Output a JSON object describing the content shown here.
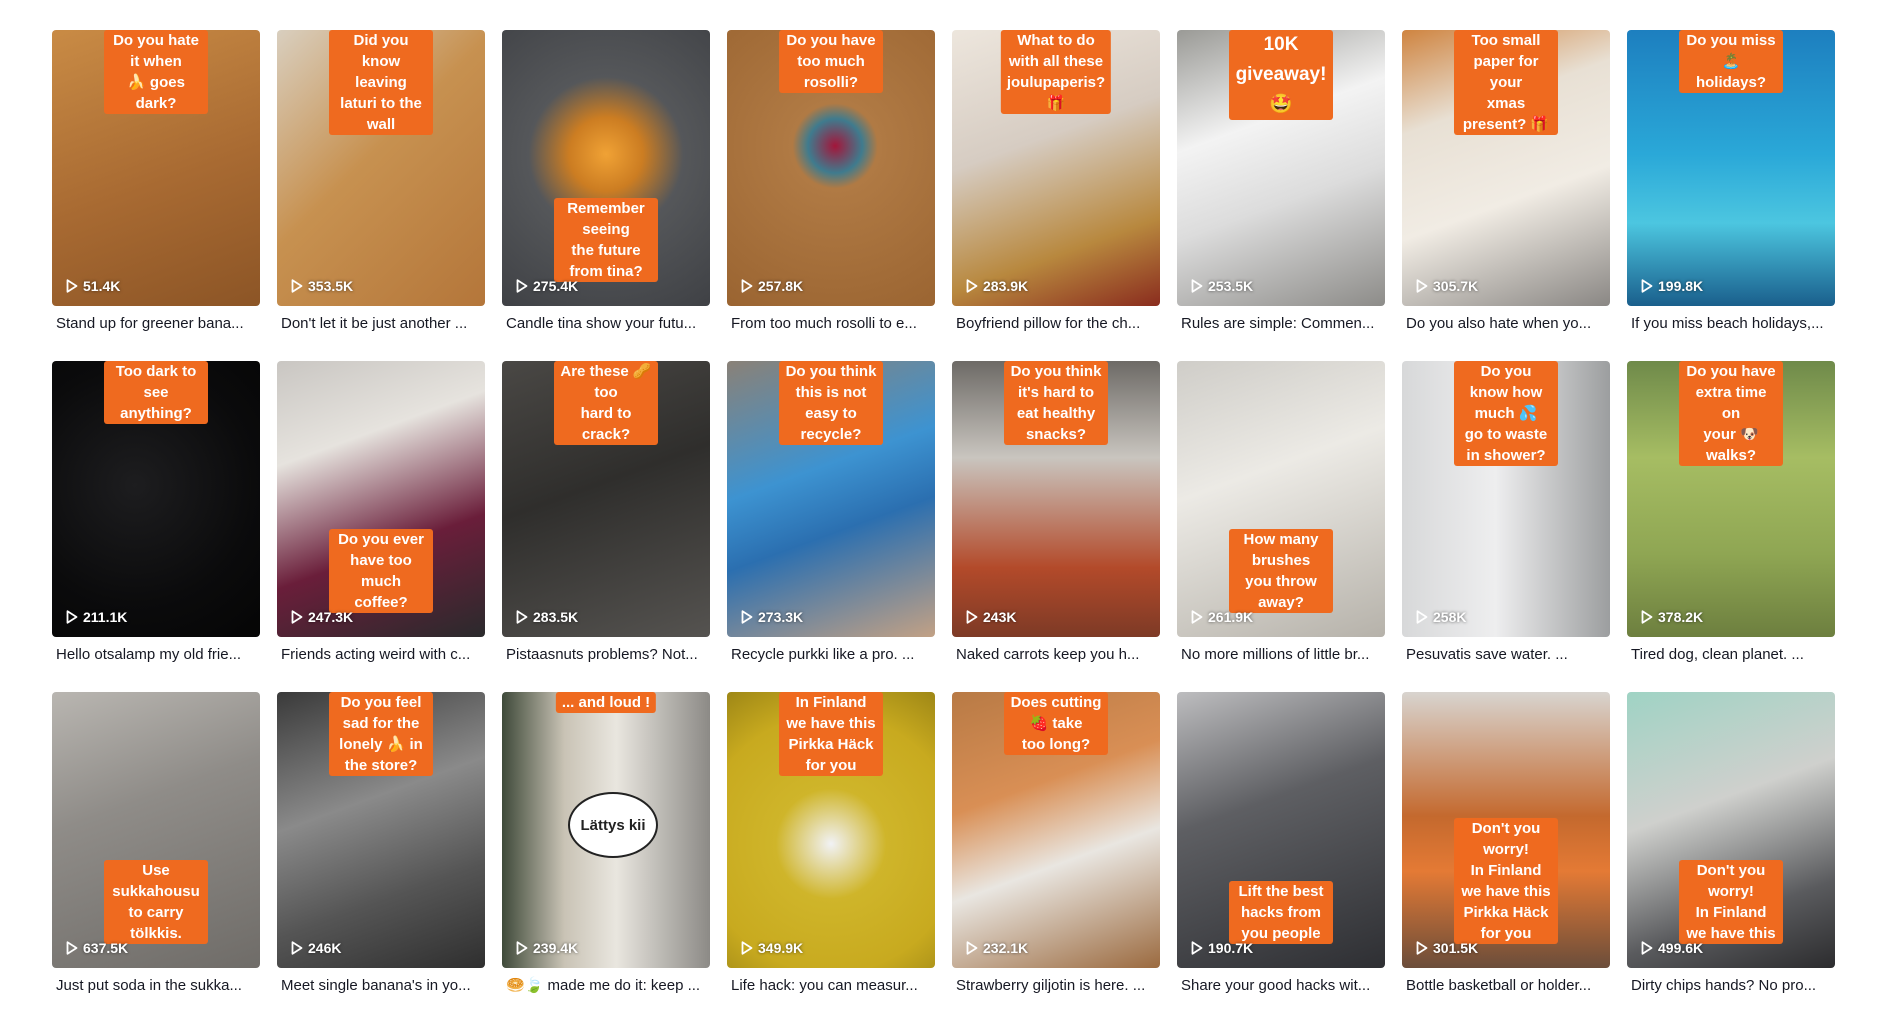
{
  "videos": [
    {
      "caption": "Do you hate it when\n🍌 goes dark?",
      "caption_pos": "top",
      "views": "51.4K",
      "desc": "Stand up for greener bana...",
      "bg": "linear-gradient(160deg,#c98b45 0%,#a86a32 55%,#8c5526 100%)"
    },
    {
      "caption": "Did you know leaving\nlaturi to the wall",
      "caption_pos": "top",
      "views": "353.5K",
      "desc": "Don't let it be just another ...",
      "bg": "linear-gradient(135deg,#d9cfbf 0%,#c79150 45%,#b4763a 100%)"
    },
    {
      "caption": "Remember seeing\nthe future from tina?",
      "caption_pos": "bottom",
      "views": "275.4K",
      "desc": "Candle tina show your futu...",
      "bg": "radial-gradient(circle at 50% 45%,#f0a235 0%,#cc7d22 20%,#55575a 42%,#3f4145 100%)"
    },
    {
      "caption": "Do you have\ntoo much rosolli?",
      "caption_pos": "top",
      "views": "257.8K",
      "desc": "From too much rosolli to e...",
      "bg": "radial-gradient(circle at 52% 42%,#a3163a 0%,#3f7b8e 14%,#b07a44 22%,#9a6431 100%)"
    },
    {
      "caption": "What to do with all these\njoulupaperis? 🎁",
      "caption_pos": "top",
      "views": "283.9K",
      "desc": "Boyfriend pillow for the ch...",
      "bg": "linear-gradient(160deg,#ede6dd 0%,#d6ccc2 40%,#b8883e 75%,#8a2c1e 100%)"
    },
    {
      "caption": "10K giveaway! 🤩",
      "caption_pos": "top",
      "wide": true,
      "views": "253.5K",
      "desc": "Rules are simple: Commen...",
      "bg": "linear-gradient(160deg,#9a9a96 0%,#f3f3f3 35%,#dcdcdc 60%,#8d8c89 100%)"
    },
    {
      "caption": "Too small paper for your\nxmas present? 🎁",
      "caption_pos": "top",
      "views": "305.7K",
      "desc": "Do you also hate when yo...",
      "bg": "linear-gradient(160deg,#cf8440 0%,#e8e0d4 30%,#f1ece4 60%,#8a8784 100%)"
    },
    {
      "caption": "Do you miss 🏝️ holidays?",
      "caption_pos": "top",
      "views": "199.8K",
      "desc": "If you miss beach holidays,...",
      "bg": "linear-gradient(180deg,#1d7fbf 0%,#2aa8d8 45%,#4cc6e0 70%,#1a5f8c 100%)"
    },
    {
      "caption": "Too dark to see anything?",
      "caption_pos": "top",
      "views": "211.1K",
      "desc": "Hello otsalamp my old frie...",
      "bg": "radial-gradient(circle at 40% 45%,#1d1d1f 0%,#0b0b0c 60%,#050505 100%)"
    },
    {
      "caption": "Do you ever have too\nmuch coffee?",
      "caption_pos": "bottom",
      "views": "247.3K",
      "desc": "Friends acting weird with c...",
      "bg": "linear-gradient(160deg,#c9c6c2 0%,#e6e3de 30%,#6a1e3a 65%,#2a2a2c 100%)"
    },
    {
      "caption": "Are these 🥜 too\nhard to crack?",
      "caption_pos": "top",
      "views": "283.5K",
      "desc": "Pistaasnuts problems? Not...",
      "bg": "linear-gradient(160deg,#4a4845 0%,#2f2e2c 45%,#555350 100%)"
    },
    {
      "caption": "Do you think this is not\neasy to recycle?",
      "caption_pos": "top",
      "views": "273.3K",
      "desc": "Recycle purkki like a pro. ...",
      "bg": "linear-gradient(160deg,#8a8177 0%,#3d93d1 40%,#2b6fb0 60%,#c2a185 100%)"
    },
    {
      "caption": "Do you think it's hard to\neat healthy snacks?",
      "caption_pos": "top",
      "views": "243K",
      "desc": "Naked carrots keep you h...",
      "bg": "linear-gradient(180deg,#6d6a66 0%,#c9c5bf 35%,#b34a2a 75%,#7d3a26 100%)"
    },
    {
      "caption": "How many brushes\nyou throw away?",
      "caption_pos": "bottom",
      "views": "261.9K",
      "desc": "No more millions of little br...",
      "bg": "linear-gradient(160deg,#cfcdc8 0%,#eceae5 40%,#b6b2aa 100%)"
    },
    {
      "caption": "Do you know how much 💦\ngo to waste in shower?",
      "caption_pos": "top",
      "views": "258K",
      "desc": "Pesuvatis save water. ...",
      "bg": "linear-gradient(90deg,#d7d8d9 0%,#eeeeef 45%,#9c9e9f 100%)"
    },
    {
      "caption": "Do you have extra time on\nyour 🐶 walks?",
      "caption_pos": "top",
      "views": "378.2K",
      "desc": "Tired dog, clean planet. ...",
      "bg": "linear-gradient(180deg,#6f8a4a 0%,#a6bd63 35%,#8fa653 70%,#6d7f3f 100%)"
    },
    {
      "caption": "Use sukkahousu\nto carry tölkkis.",
      "caption_pos": "bottom",
      "views": "637.5K",
      "desc": "Just put soda in the sukka...",
      "bg": "linear-gradient(160deg,#b9b6b1 0%,#8f8c88 40%,#6f6c68 100%)"
    },
    {
      "caption": "Do you feel sad for the\nlonely 🍌 in the store?",
      "caption_pos": "top",
      "views": "246K",
      "desc": "Meet single banana's in yo...",
      "bg": "linear-gradient(160deg,#3a3a3a 0%,#8a8a8a 40%,#555 70%,#2f2f2f 100%)"
    },
    {
      "caption": "... and loud !",
      "caption_pos": "top",
      "views": "239.4K",
      "desc": "🥯🍃 made me do it: keep ...",
      "bg": "linear-gradient(90deg,#3f4a3a 0%,#c9c3b5 30%,#e9e6df 55%,#8c8a86 100%)"
    },
    {
      "caption": "In Finland we have this\nPirkka Häck for you",
      "caption_pos": "top",
      "views": "349.9K",
      "desc": "Life hack: you can measur...",
      "bg": "radial-gradient(circle at 50% 55%,#f1f2f5 0%,#cfb52a 30%,#c8aa1f 70%,#9e8716 100%)"
    },
    {
      "caption": "Does cutting 🍓 take\ntoo long?",
      "caption_pos": "top",
      "views": "232.1K",
      "desc": "Strawberry giljotin is here. ...",
      "bg": "linear-gradient(160deg,#b87a45 0%,#d98f55 35%,#e9e6e1 60%,#9b6a3f 100%)"
    },
    {
      "caption": "Lift the best hacks from\nyou people",
      "caption_pos": "bottom",
      "views": "190.7K",
      "desc": "Share your good hacks wit...",
      "bg": "linear-gradient(160deg,#bdbdbf 0%,#5e5f63 40%,#2e2f33 100%)"
    },
    {
      "caption": "Don't you worry!\nIn Finland we have this\nPirkka Häck for you",
      "caption_pos": "bottom",
      "views": "301.5K",
      "desc": "Bottle basketball or holder...",
      "bg": "linear-gradient(180deg,#d8d4cf 0%,#c4692e 45%,#e47a35 65%,#6b4d3a 100%)"
    },
    {
      "caption": "Don't you worry!\nIn Finland we have this",
      "caption_pos": "bottom",
      "views": "499.6K",
      "desc": "Dirty chips hands? No pro...",
      "bg": "linear-gradient(160deg,#9fd3c4 0%,#cfd0cd 40%,#5a5b5e 75%,#2c2c2e 100%)"
    }
  ],
  "speech_bubble": "Lättys kii",
  "icons": {
    "play": "play-icon"
  },
  "colors": {
    "caption_bg": "#ef6a1f",
    "text": "#161823"
  }
}
